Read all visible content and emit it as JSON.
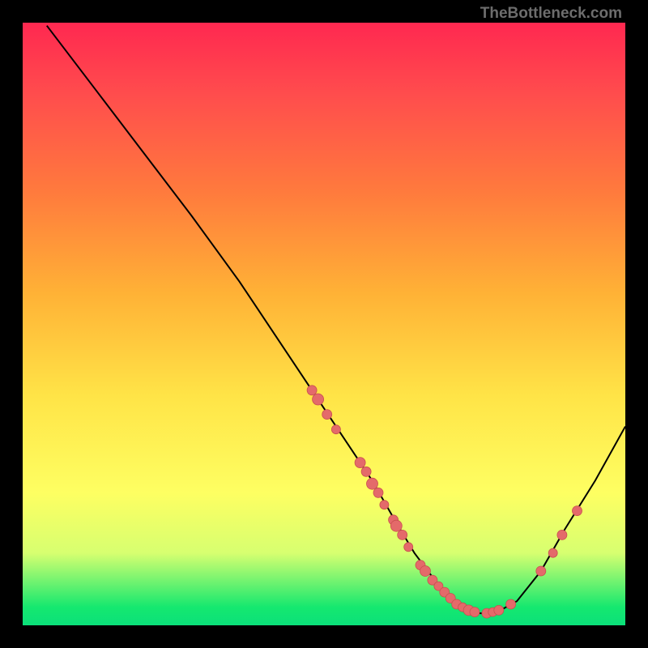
{
  "watermark": "TheBottleneck.com",
  "chart_data": {
    "type": "line",
    "title": "",
    "xlabel": "",
    "ylabel": "",
    "xlim": [
      0,
      100
    ],
    "ylim": [
      0,
      100
    ],
    "curve": {
      "x": [
        4,
        12,
        20,
        28,
        36,
        42,
        48,
        54,
        58,
        62,
        65,
        68,
        70,
        72,
        74,
        78,
        82,
        86,
        90,
        95,
        100
      ],
      "y": [
        99.5,
        89,
        78.5,
        68,
        57,
        48,
        39,
        30,
        24,
        17,
        12,
        8,
        5.5,
        3.5,
        2.2,
        1.8,
        4,
        9,
        16,
        24,
        33
      ]
    },
    "series": [
      {
        "name": "points",
        "pts": [
          {
            "x": 48,
            "y": 39,
            "r": 6
          },
          {
            "x": 49,
            "y": 37.5,
            "r": 7
          },
          {
            "x": 50.5,
            "y": 35,
            "r": 6
          },
          {
            "x": 52,
            "y": 32.5,
            "r": 5.5
          },
          {
            "x": 56,
            "y": 27,
            "r": 6.5
          },
          {
            "x": 57,
            "y": 25.5,
            "r": 6
          },
          {
            "x": 58,
            "y": 23.5,
            "r": 7
          },
          {
            "x": 59,
            "y": 22,
            "r": 6
          },
          {
            "x": 60,
            "y": 20,
            "r": 5.5
          },
          {
            "x": 61.5,
            "y": 17.5,
            "r": 6
          },
          {
            "x": 62,
            "y": 16.5,
            "r": 7
          },
          {
            "x": 63,
            "y": 15,
            "r": 6
          },
          {
            "x": 64,
            "y": 13,
            "r": 5.5
          },
          {
            "x": 66,
            "y": 10,
            "r": 6
          },
          {
            "x": 66.8,
            "y": 9,
            "r": 6.5
          },
          {
            "x": 68,
            "y": 7.5,
            "r": 6
          },
          {
            "x": 69,
            "y": 6.5,
            "r": 5.5
          },
          {
            "x": 70,
            "y": 5.5,
            "r": 6
          },
          {
            "x": 71,
            "y": 4.5,
            "r": 6
          },
          {
            "x": 72,
            "y": 3.5,
            "r": 6
          },
          {
            "x": 73,
            "y": 3,
            "r": 5.5
          },
          {
            "x": 74,
            "y": 2.5,
            "r": 6.5
          },
          {
            "x": 75,
            "y": 2.2,
            "r": 6
          },
          {
            "x": 77,
            "y": 2,
            "r": 6
          },
          {
            "x": 78,
            "y": 2.2,
            "r": 5.5
          },
          {
            "x": 79,
            "y": 2.5,
            "r": 6
          },
          {
            "x": 81,
            "y": 3.5,
            "r": 6
          },
          {
            "x": 86,
            "y": 9,
            "r": 6
          },
          {
            "x": 88,
            "y": 12,
            "r": 5.5
          },
          {
            "x": 89.5,
            "y": 15,
            "r": 6
          },
          {
            "x": 92,
            "y": 19,
            "r": 6
          }
        ]
      }
    ]
  }
}
